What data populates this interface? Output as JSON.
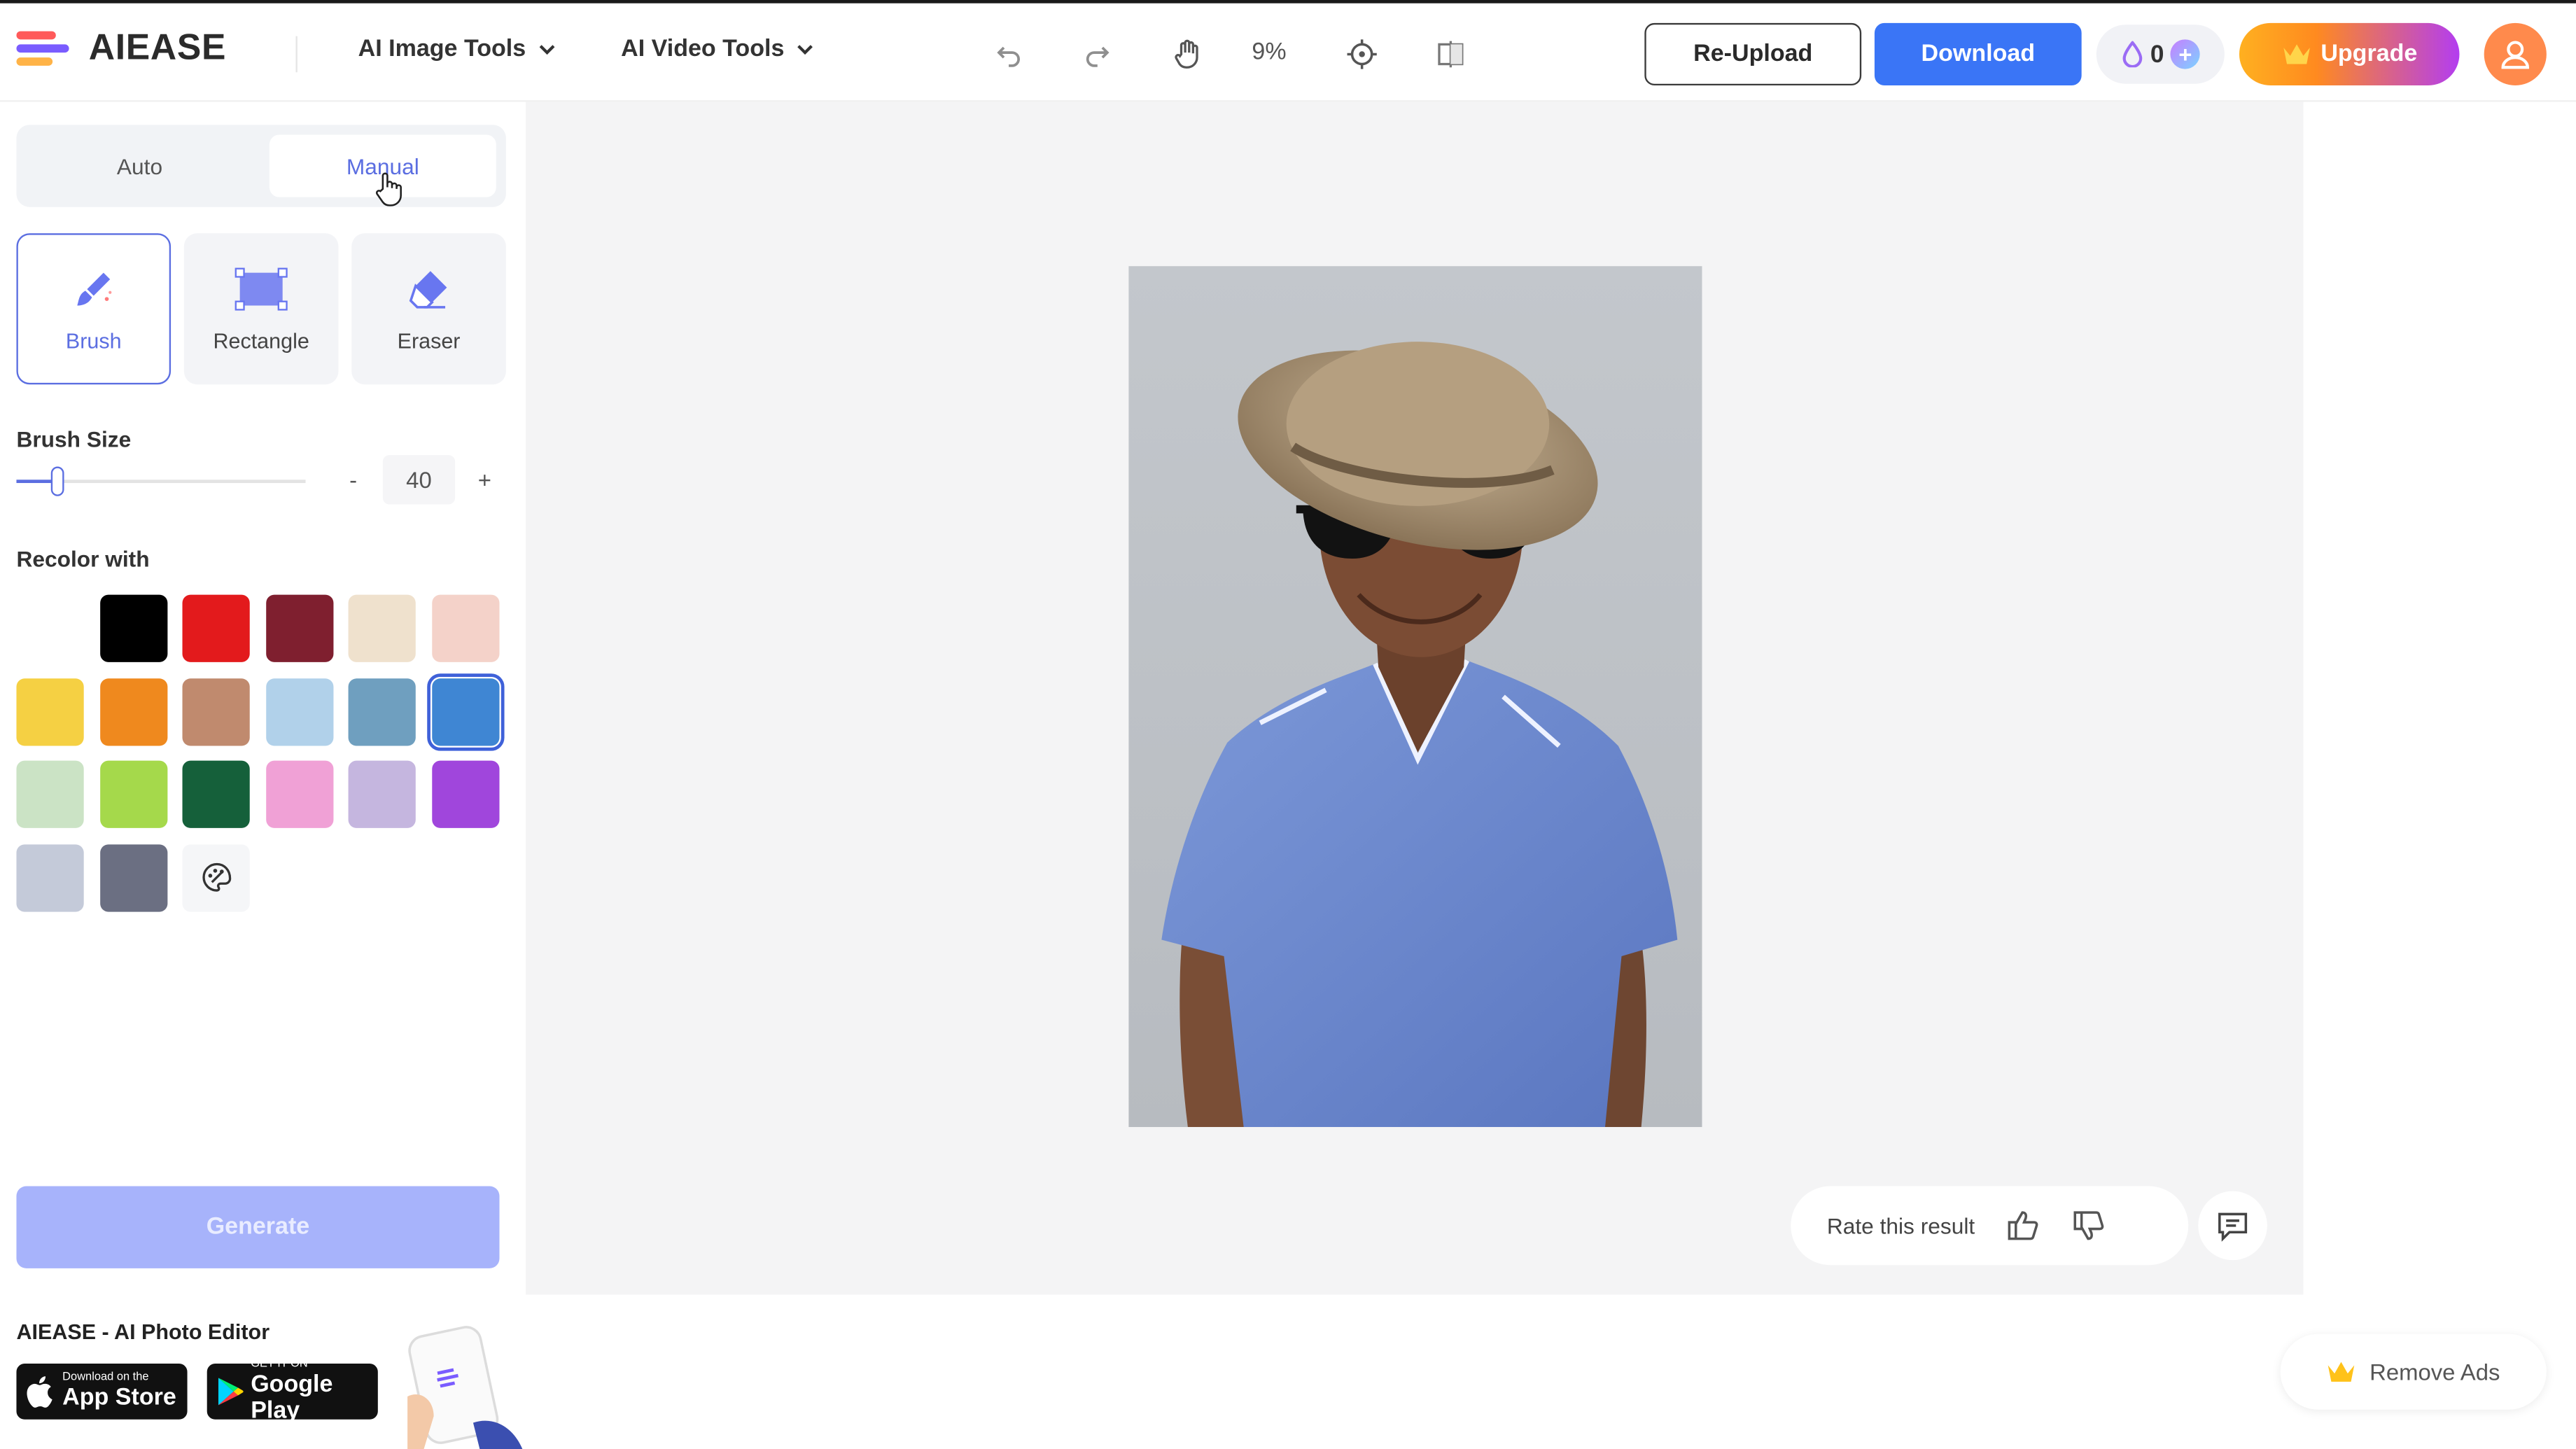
{
  "header": {
    "logo_text": "AIEASE",
    "nav": [
      {
        "label": "AI Image Tools"
      },
      {
        "label": "AI Video Tools"
      }
    ],
    "zoom_level": "9%",
    "reupload_label": "Re-Upload",
    "download_label": "Download",
    "credits_count": "0",
    "credits_add": "+",
    "upgrade_label": "Upgrade",
    "icons": [
      "undo-icon",
      "redo-icon",
      "hand-icon",
      "target-icon",
      "compare-icon",
      "crown-icon",
      "user-icon"
    ]
  },
  "sidebar": {
    "mode_tabs": [
      {
        "label": "Auto",
        "active": false
      },
      {
        "label": "Manual",
        "active": true
      }
    ],
    "tools": [
      {
        "label": "Brush",
        "active": true,
        "icon": "brush-icon"
      },
      {
        "label": "Rectangle",
        "active": false,
        "icon": "rectangle-select-icon"
      },
      {
        "label": "Eraser",
        "active": false,
        "icon": "eraser-icon"
      }
    ],
    "brush_size_label": "Brush Size",
    "brush_size": {
      "value": "40",
      "minus": "-",
      "plus": "+",
      "slider_fraction": 0.14
    },
    "recolor_label": "Recolor with",
    "swatches": [
      "#ffffff",
      "#000000",
      "#e31a1c",
      "#7f1f2f",
      "#efe1cd",
      "#f4d2c9",
      "#f5d043",
      "#ef891e",
      "#c08a6e",
      "#b1d1ea",
      "#6f9fbf",
      "#3f86d3",
      "#cbe3c5",
      "#a5d94b",
      "#15603a",
      "#f0a1d6",
      "#c5b6df",
      "#a046dc",
      "#c4cad9",
      "#6b6f82"
    ],
    "selected_swatch": "#3f86d3",
    "custom_color_icon": "palette-icon",
    "generate_label": "Generate",
    "promo_title": "AIEASE - AI Photo Editor",
    "app_store": {
      "small": "Download on the",
      "big": "App Store"
    },
    "google_play": {
      "small": "GET IT ON",
      "big": "Google Play"
    }
  },
  "workspace": {
    "rate_label": "Rate this result",
    "icons": [
      "thumbs-up-icon",
      "thumbs-down-icon",
      "feedback-icon"
    ]
  },
  "remove_ads_label": "Remove Ads",
  "colors": {
    "accent": "#5b6ee1",
    "download": "#3a75f6",
    "generate_disabled": "#a7b3fb",
    "avatar": "#ff8a4c"
  }
}
